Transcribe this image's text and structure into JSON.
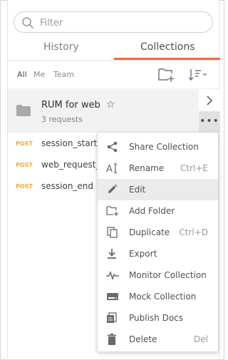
{
  "search": {
    "placeholder": "Filter"
  },
  "tabs": {
    "history": "History",
    "collections": "Collections"
  },
  "filters": {
    "all": "All",
    "me": "Me",
    "team": "Team"
  },
  "collection": {
    "name": "RUM for web",
    "count": "3 requests"
  },
  "requests": [
    {
      "method": "POST",
      "name": "session_start"
    },
    {
      "method": "POST",
      "name": "web_request_"
    },
    {
      "method": "POST",
      "name": "session_end"
    }
  ],
  "menu": [
    {
      "icon": "share-icon",
      "label": "Share Collection",
      "shortcut": ""
    },
    {
      "icon": "rename-icon",
      "label": "Rename",
      "shortcut": "Ctrl+E"
    },
    {
      "icon": "pencil-icon",
      "label": "Edit",
      "shortcut": ""
    },
    {
      "icon": "add-folder-icon",
      "label": "Add Folder",
      "shortcut": ""
    },
    {
      "icon": "duplicate-icon",
      "label": "Duplicate",
      "shortcut": "Ctrl+D"
    },
    {
      "icon": "export-icon",
      "label": "Export",
      "shortcut": ""
    },
    {
      "icon": "monitor-icon",
      "label": "Monitor Collection",
      "shortcut": ""
    },
    {
      "icon": "mock-icon",
      "label": "Mock Collection",
      "shortcut": ""
    },
    {
      "icon": "publish-docs-icon",
      "label": "Publish Docs",
      "shortcut": ""
    },
    {
      "icon": "trash-icon",
      "label": "Delete",
      "shortcut": "Del"
    }
  ],
  "colors": {
    "accent": "#f26b3a",
    "post": "#f2a93b"
  }
}
